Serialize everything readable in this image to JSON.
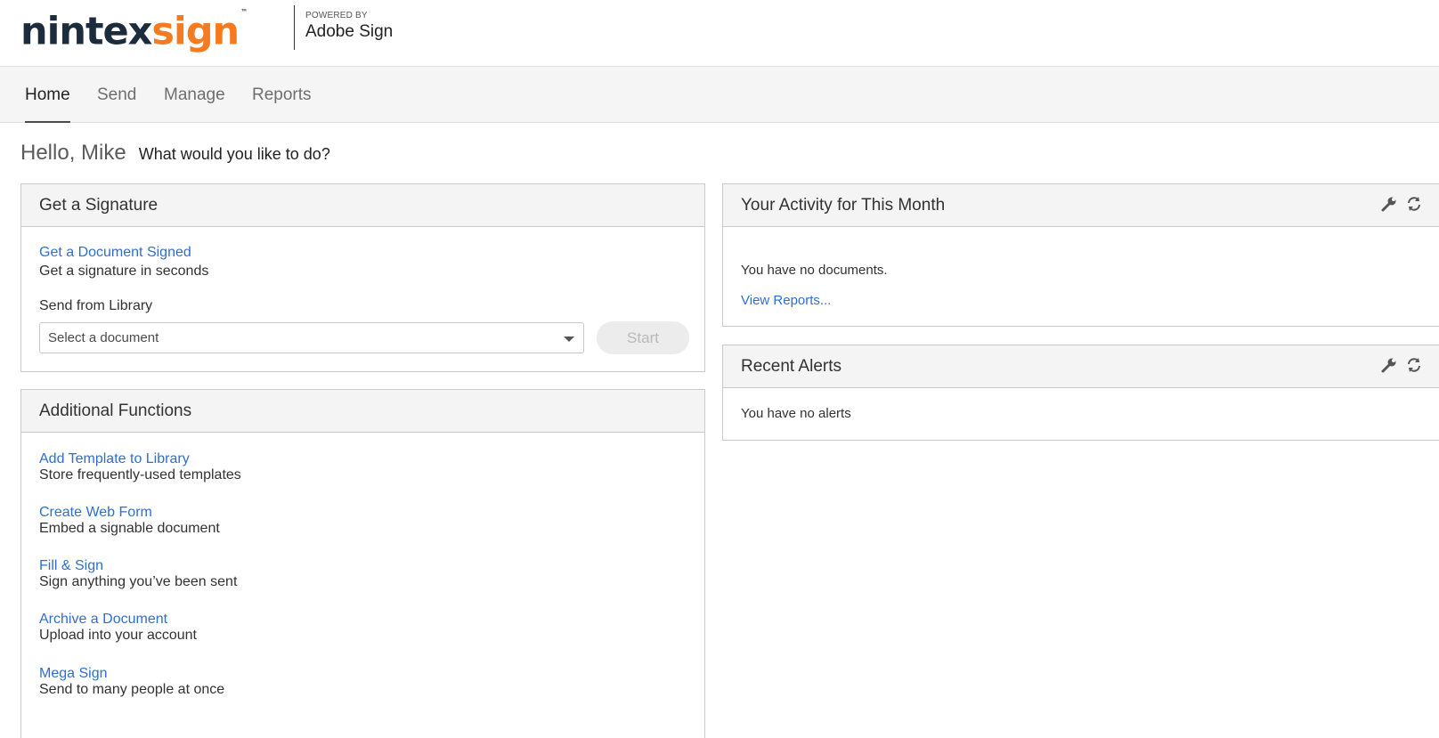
{
  "header": {
    "logo_part1": "nintex",
    "logo_part2": "sign",
    "logo_tm": "™",
    "powered_by": "POWERED BY",
    "powered_brand": "Adobe Sign"
  },
  "nav": {
    "tabs": [
      {
        "label": "Home",
        "active": true
      },
      {
        "label": "Send",
        "active": false
      },
      {
        "label": "Manage",
        "active": false
      },
      {
        "label": "Reports",
        "active": false
      }
    ]
  },
  "greeting": {
    "hello": "Hello, Mike",
    "question": "What would you like to do?"
  },
  "get_signature": {
    "title": "Get a Signature",
    "link": "Get a Document Signed",
    "desc": "Get a signature in seconds",
    "library_label": "Send from Library",
    "select_value": "Select a document",
    "start_label": "Start"
  },
  "additional": {
    "title": "Additional Functions",
    "items": [
      {
        "link": "Add Template to Library",
        "desc": "Store frequently-used templates"
      },
      {
        "link": "Create Web Form",
        "desc": "Embed a signable document"
      },
      {
        "link": "Fill & Sign",
        "desc": "Sign anything you’ve been sent"
      },
      {
        "link": "Archive a Document",
        "desc": "Upload into your account"
      },
      {
        "link": "Mega Sign",
        "desc": "Send to many people at once"
      }
    ]
  },
  "activity": {
    "title": "Your Activity for This Month",
    "message": "You have no documents.",
    "link": "View Reports..."
  },
  "alerts": {
    "title": "Recent Alerts",
    "message": "You have no alerts"
  },
  "icons": {
    "settings": "wrench-icon",
    "refresh": "refresh-icon"
  },
  "colors": {
    "brand_dark": "#1c2c3c",
    "brand_orange": "#f47b20",
    "link": "#2f6fcf"
  }
}
